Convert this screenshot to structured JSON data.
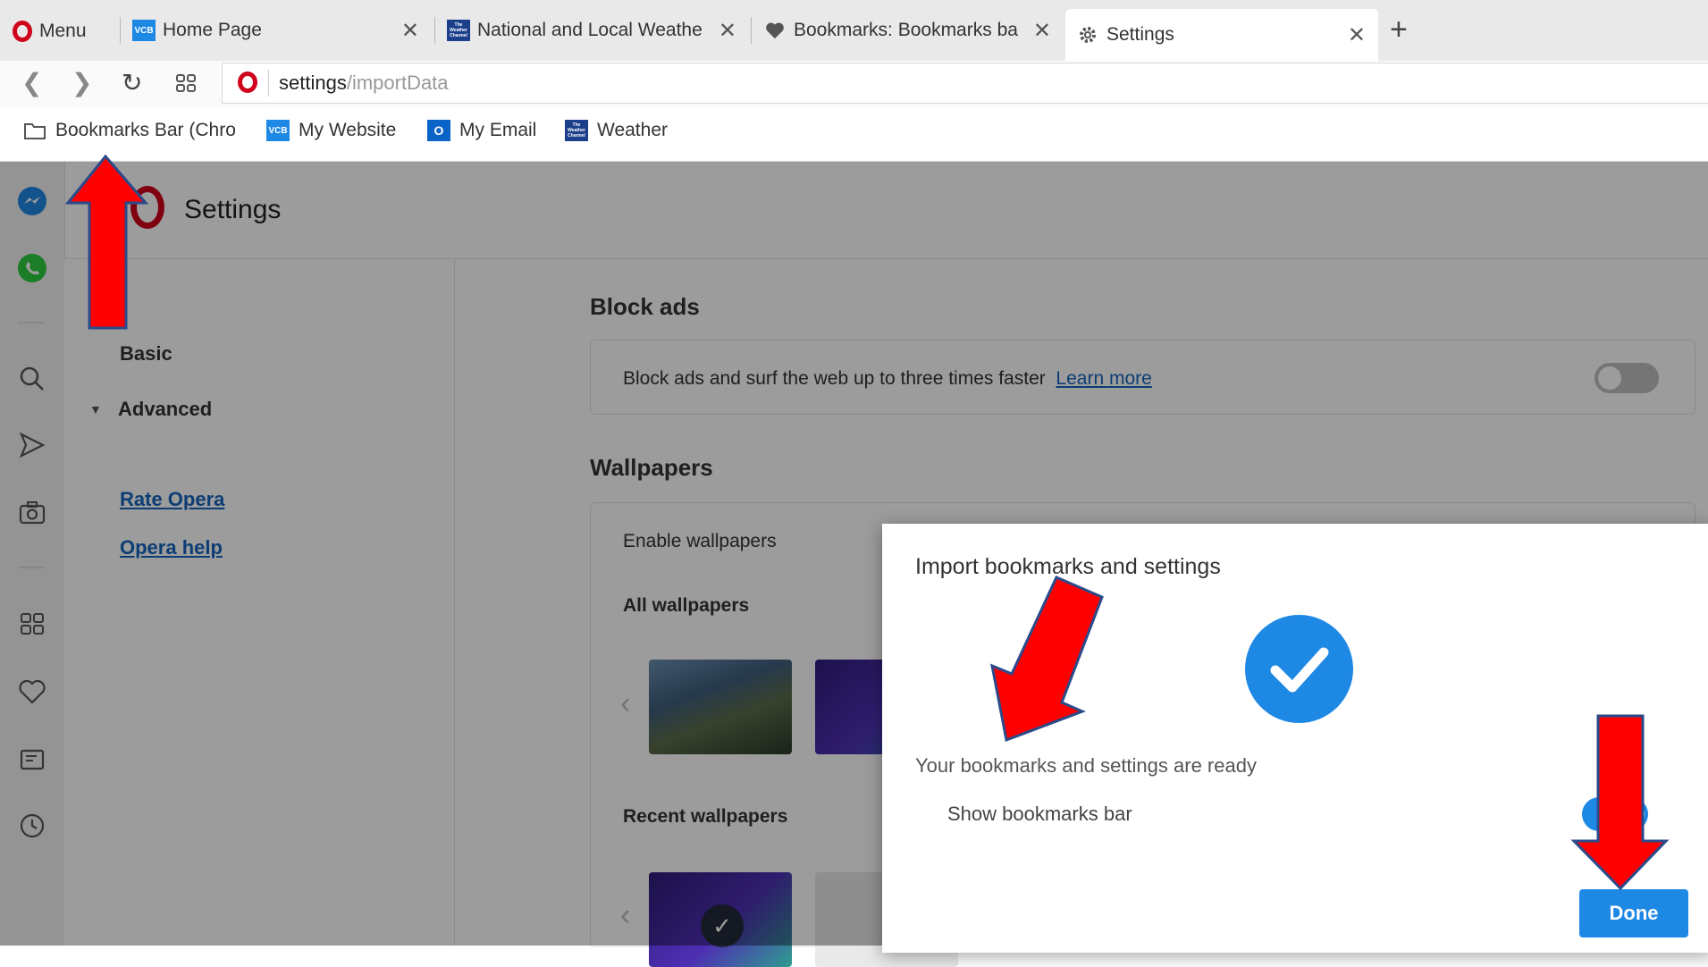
{
  "browser": {
    "menu_label": "Menu",
    "tabs": [
      {
        "title": "Home Page",
        "icon": "vcb-favicon",
        "favicon_text": "VCB",
        "close": "✕"
      },
      {
        "title": "National and Local Weathe",
        "icon": "weather-channel-favicon",
        "favicon_text": "The Weather Channel",
        "close": "✕"
      },
      {
        "title": "Bookmarks: Bookmarks ba",
        "icon": "heart-icon",
        "close": "✕"
      },
      {
        "title": "Settings",
        "icon": "gear-icon",
        "close": "✕",
        "active": true
      }
    ],
    "new_tab": "+",
    "address": {
      "host": "settings",
      "path": "/importData"
    },
    "bookmarks": [
      {
        "label": "Bookmarks Bar (Chro",
        "icon": "folder-icon"
      },
      {
        "label": "My Website",
        "icon": "vcb-favicon",
        "favicon_text": "VCB"
      },
      {
        "label": "My Email",
        "icon": "outlook-icon",
        "favicon_text": "O"
      },
      {
        "label": "Weather",
        "icon": "weather-channel-favicon",
        "favicon_text": "The Weather Channel"
      }
    ]
  },
  "settings": {
    "title": "Settings",
    "nav": {
      "basic": "Basic",
      "advanced": "Advanced",
      "rate": "Rate Opera",
      "help": "Opera help"
    },
    "block_ads": {
      "heading": "Block ads",
      "text": "Block ads and surf the web up to three times faster",
      "link": "Learn more",
      "enabled": false
    },
    "wallpapers": {
      "heading": "Wallpapers",
      "enable_label": "Enable wallpapers",
      "all_label": "All wallpapers",
      "recent_label": "Recent wallpapers"
    }
  },
  "dialog": {
    "title": "Import bookmarks and settings",
    "status": "Your bookmarks and settings are ready",
    "option_label": "Show bookmarks bar",
    "option_enabled": true,
    "done_label": "Done"
  },
  "colors": {
    "accent": "#1e88e5",
    "opera_red": "#d0021b",
    "annotation_arrow": "#ff0000"
  }
}
